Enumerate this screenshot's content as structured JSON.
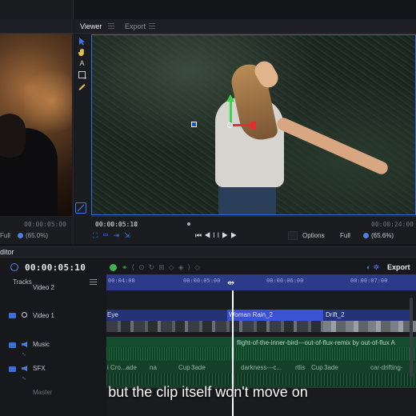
{
  "left_viewer": {
    "timecode": "00:00:05:00",
    "fit": "Full",
    "zoom": "(65.0%)"
  },
  "viewer": {
    "tabs": [
      "Viewer",
      "Export"
    ],
    "tools": [
      "select-arrow-icon",
      "hand-icon",
      "text-icon",
      "crop-icon",
      "pen-icon"
    ],
    "timecode": "00:00:05:10",
    "duration": "00:00:24:00",
    "transport": "⏮◀II▶▶",
    "options_label": "Options",
    "fit_label": "Full",
    "zoom_label": "(65.6%)"
  },
  "editor": {
    "title": "ditor",
    "timecode": "00:00:05:10",
    "export_label": "Export",
    "tracks_label": "Tracks",
    "ruler": [
      "00:04:00",
      "00:00:05:00",
      "00:00:06:00",
      "00:00:07:00"
    ],
    "tracks": [
      {
        "name": "Video 2"
      },
      {
        "name": "Video 1"
      },
      {
        "name": "Music"
      },
      {
        "name": "SFX"
      },
      {
        "name": "Master"
      }
    ],
    "clips": {
      "video1_a": "Eye",
      "video1_b": "Woman Rain_2",
      "video1_c": "Drift_2",
      "music": "flight-of-the-inner-bird---out-of-flux-remix by out-of-flux A",
      "sfx_a": "i Cro...ade",
      "sfx_b": "na",
      "sfx_c": "Cup",
      "sfx_d": "3ade",
      "sfx_e": "darkness---c...",
      "sfx_f": "rtlis",
      "sfx_g": "Cup",
      "sfx_h": "3ade",
      "sfx_i": "car-drifting-"
    }
  },
  "subtitle": "but the clip itself won't move on",
  "colors": {
    "accent": "#2f6fe6",
    "video_track": "#243278",
    "selected_clip": "#3a52d6",
    "music_track": "#134d2e",
    "playhead": "#ffffff"
  }
}
